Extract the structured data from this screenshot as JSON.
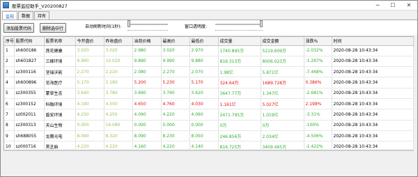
{
  "window": {
    "title": "股票监控助手_V20200827",
    "minimize": "─",
    "maximize": "☐",
    "close": "✕"
  },
  "tabs": [
    {
      "label": "监视",
      "active": true
    },
    {
      "label": "数据",
      "active": false
    },
    {
      "label": "持有",
      "active": false
    }
  ],
  "toolbar": {
    "add_button": "添加股票代码",
    "delete_button": "删除选中行",
    "refresh_label": "自动刷新时间(1秒):",
    "opacity_label": "窗口透明度:",
    "refresh_level": 0.0,
    "opacity_level": 1.0
  },
  "colors": {
    "up": "#e01010",
    "down": "#2fae2f",
    "flat": "#99c255"
  },
  "table": {
    "columns": [
      "序号",
      "股票代码",
      "股票名称",
      "今开盘价",
      "昨收盘价",
      "当前价格",
      "最高价",
      "最低价",
      "成交量",
      "成交金额",
      "涨跌%",
      "时间"
    ],
    "rows": [
      {
        "cells": [
          "1",
          "sh600186",
          "莲花健康",
          "3.020",
          "3.020",
          "2.980",
          "3.020",
          "2.970",
          "1740.895万",
          "5219.609万",
          "-2.032%",
          "2020-08-28 10:43:34"
        ],
        "trend": "down"
      },
      {
        "cells": [
          "2",
          "sh601827",
          "三峰环境",
          "9.990",
          "10.020",
          "9.890",
          "9.990",
          "9.880",
          "816.313万",
          "8006.023万",
          "-1.297%",
          "2020-08-28 10:43:34"
        ],
        "trend": "down"
      },
      {
        "cells": [
          "3",
          "sz300116",
          "坚瑞沃能",
          "2.270",
          "2.220",
          "2.080",
          "2.270",
          "2.070",
          "1.98亿",
          "5.871亿",
          "-7.468%",
          "2020-08-28 10:43:34"
        ],
        "trend": "down"
      },
      {
        "cells": [
          "4",
          "sh600896",
          "览海医疗",
          "5.170",
          "5.180",
          "5.200",
          "5.230",
          "5.170",
          "324.64万",
          "1689.728万",
          "0.386%",
          "2020-08-28 10:43:34"
        ],
        "trend": "up"
      },
      {
        "cells": [
          "5",
          "sz300355",
          "蒙草生态",
          "3.640",
          "3.780",
          "3.690",
          "3.790",
          "3.620",
          "3647.77万",
          "1.347亿",
          "-2.681%",
          "2020-08-28 10:43:34"
        ],
        "trend": "down"
      },
      {
        "cells": [
          "6",
          "sz300152",
          "科融环境",
          "4.190",
          "4.550",
          "4.650",
          "4.760",
          "4.030",
          "1.161亿",
          "5.027亿",
          "2.198%",
          "2020-08-28 10:43:34"
        ],
        "trend": "up"
      },
      {
        "cells": [
          "7",
          "sz002011",
          "盾安环境",
          "4.250",
          "4.250",
          "4.090",
          "4.220",
          "4.060",
          "2471.795万",
          "1.019亿",
          "-3.31%",
          "2020-08-28 10:43:34"
        ],
        "trend": "down"
      },
      {
        "cells": [
          "8",
          "sz300313",
          "天山生物",
          "0.000",
          "16.080",
          "0.000",
          "0.000",
          "0.000",
          "0万",
          "0万",
          "-100%",
          "2020-08-28 10:43:34"
        ],
        "trend": "down"
      },
      {
        "cells": [
          "9",
          "sh688055",
          "龙腾光电",
          "8.090",
          "8.320",
          "8.090",
          "8.230",
          "8.050",
          "246.856万",
          "2.034亿",
          "-4.506%",
          "2020-08-28 10:43:34"
        ],
        "trend": "down"
      },
      {
        "cells": [
          "10",
          "sz000716",
          "黑芝麻",
          "4.220",
          "4.220",
          "4.160",
          "4.220",
          "4.140",
          "816.725万",
          "3409.465万",
          "-1.422%",
          "2020-08-28 10:43:34"
        ],
        "trend": "down"
      }
    ]
  }
}
